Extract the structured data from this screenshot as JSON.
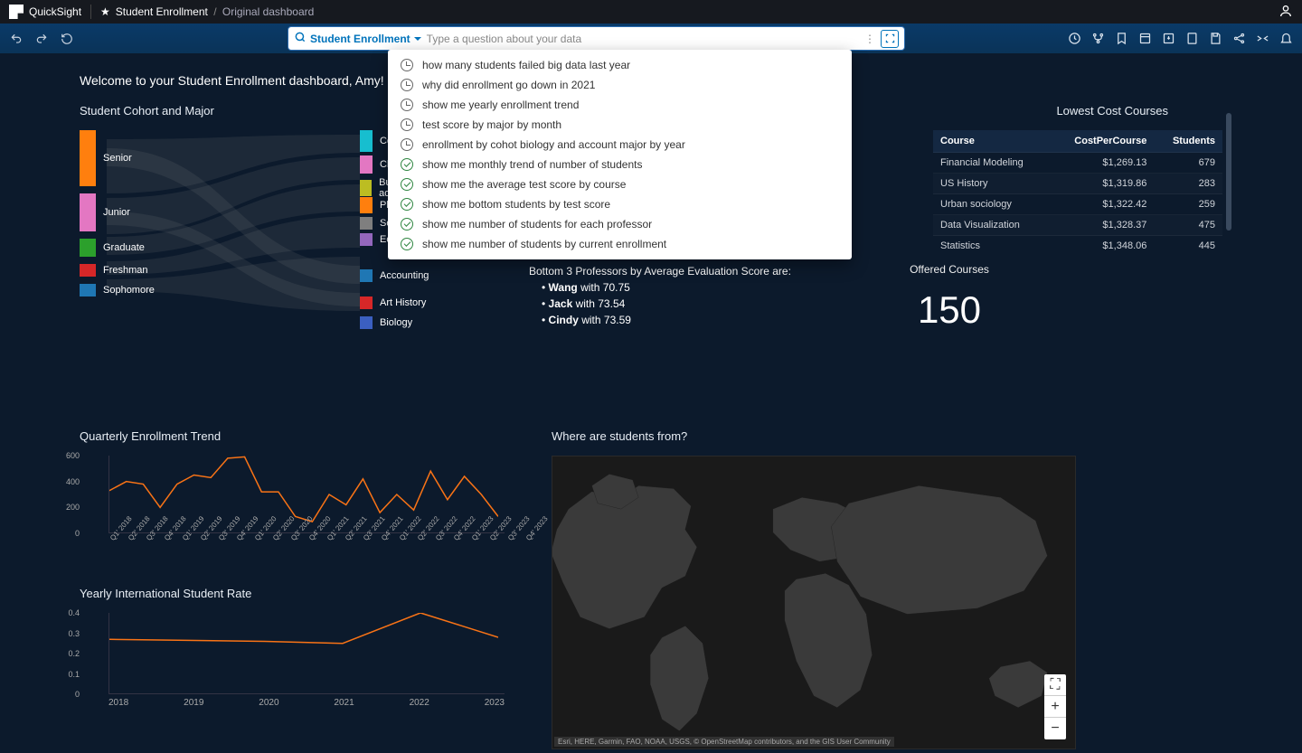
{
  "header": {
    "app": "QuickSight",
    "breadcrumb_root": "Student Enrollment",
    "breadcrumb_current": "Original dashboard"
  },
  "qbar": {
    "topic": "Student Enrollment",
    "placeholder": "Type a question about your data"
  },
  "suggestions": [
    {
      "icon": "clock",
      "text": "how many students failed big data last year"
    },
    {
      "icon": "clock",
      "text": "why did enrollment go down in 2021"
    },
    {
      "icon": "clock",
      "text": "show me yearly enrollment trend"
    },
    {
      "icon": "clock",
      "text": "test score by major by month"
    },
    {
      "icon": "clock",
      "text": "enrollment by cohot biology and account major by year"
    },
    {
      "icon": "check",
      "text": "show me monthly trend of number of students"
    },
    {
      "icon": "check",
      "text": "show me the average test score by course"
    },
    {
      "icon": "check",
      "text": "show me bottom students by test score"
    },
    {
      "icon": "check",
      "text": "show me number of students for each professor"
    },
    {
      "icon": "check",
      "text": "show me number of students by current enrollment"
    }
  ],
  "welcome": "Welcome to your Student Enrollment dashboard, Amy!",
  "sankey": {
    "title": "Student Cohort and Major",
    "left": [
      "Senior",
      "Junior",
      "Graduate",
      "Freshman",
      "Sophomore"
    ],
    "right": [
      "Computer Science",
      "Chemistry",
      "Business administration",
      "Physics",
      "Sociology",
      "Economics & Finance",
      "Accounting",
      "Art History",
      "Biology"
    ]
  },
  "costTable": {
    "title": "Lowest Cost Courses",
    "cols": [
      "Course",
      "CostPerCourse",
      "Students"
    ],
    "rows": [
      [
        "Financial Modeling",
        "$1,269.13",
        "679"
      ],
      [
        "US History",
        "$1,319.86",
        "283"
      ],
      [
        "Urban sociology",
        "$1,322.42",
        "259"
      ],
      [
        "Data Visualization",
        "$1,328.37",
        "475"
      ],
      [
        "Statistics",
        "$1,348.06",
        "445"
      ]
    ]
  },
  "narrative": {
    "heading": "Bottom 3 Professors by Average Evaluation Score are:",
    "items": [
      {
        "name": "Wang",
        "rest": " with 70.75"
      },
      {
        "name": "Jack",
        "rest": " with 73.54"
      },
      {
        "name": "Cindy",
        "rest": " with 73.59"
      }
    ]
  },
  "kpi": {
    "label": "Offered Courses",
    "value": "150"
  },
  "chart_data": [
    {
      "type": "line",
      "title": "Quarterly Enrollment Trend",
      "categories": [
        "Q1' 2018",
        "Q2' 2018",
        "Q3' 2018",
        "Q4' 2018",
        "Q1' 2019",
        "Q2' 2019",
        "Q3' 2019",
        "Q4' 2019",
        "Q1' 2020",
        "Q2' 2020",
        "Q3' 2020",
        "Q4' 2020",
        "Q1' 2021",
        "Q2' 2021",
        "Q3' 2021",
        "Q4' 2021",
        "Q1' 2022",
        "Q2' 2022",
        "Q3' 2022",
        "Q4' 2022",
        "Q1' 2023",
        "Q2' 2023",
        "Q3' 2023",
        "Q4' 2023"
      ],
      "values": [
        330,
        400,
        380,
        200,
        380,
        450,
        430,
        580,
        590,
        320,
        320,
        130,
        90,
        300,
        220,
        420,
        160,
        300,
        180,
        480,
        260,
        440,
        300,
        130
      ],
      "ylim": [
        0,
        600
      ],
      "color": "#f97316"
    },
    {
      "type": "line",
      "title": "Yearly International Student Rate",
      "categories": [
        "2018",
        "2019",
        "2020",
        "2021",
        "2022",
        "2023"
      ],
      "values": [
        0.27,
        0.265,
        0.26,
        0.25,
        0.4,
        0.28
      ],
      "ylim": [
        0,
        0.4
      ],
      "color": "#f97316"
    }
  ],
  "map": {
    "title": "Where are students from?",
    "attribution": "Esri, HERE, Garmin, FAO, NOAA, USGS, © OpenStreetMap contributors, and the GIS User Community"
  }
}
